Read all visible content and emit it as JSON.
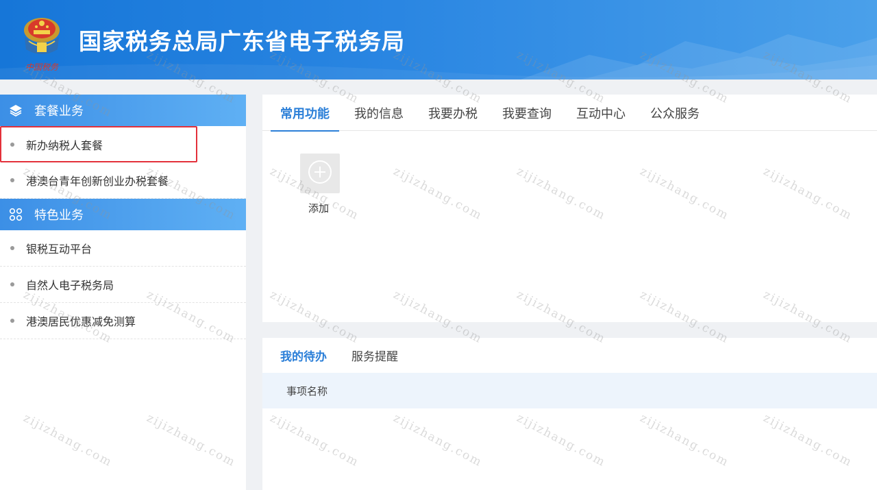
{
  "header": {
    "title": "国家税务总局广东省电子税务局",
    "emblem_caption": "中国税务",
    "colors": {
      "start": "#1676d8",
      "end": "#4aa0ea"
    }
  },
  "sidebar": {
    "sections": [
      {
        "title": "套餐业务",
        "icon": "layers-icon",
        "items": [
          {
            "label": "新办纳税人套餐",
            "selected": true
          },
          {
            "label": "港澳台青年创新创业办税套餐",
            "selected": false
          }
        ]
      },
      {
        "title": "特色业务",
        "icon": "grid-icon",
        "items": [
          {
            "label": "银税互动平台",
            "selected": false
          },
          {
            "label": "自然人电子税务局",
            "selected": false
          },
          {
            "label": "港澳居民优惠减免测算",
            "selected": false
          }
        ]
      }
    ]
  },
  "main": {
    "tabs": [
      {
        "label": "常用功能",
        "active": true
      },
      {
        "label": "我的信息",
        "active": false
      },
      {
        "label": "我要办税",
        "active": false
      },
      {
        "label": "我要查询",
        "active": false
      },
      {
        "label": "互动中心",
        "active": false
      },
      {
        "label": "公众服务",
        "active": false
      }
    ],
    "add_tile": {
      "label": "添加",
      "icon": "plus-circle-icon"
    }
  },
  "todo": {
    "tabs": [
      {
        "label": "我的待办",
        "active": true
      },
      {
        "label": "服务提醒",
        "active": false
      }
    ],
    "table_header": "事项名称"
  },
  "watermark": {
    "text": "zijizhang.com"
  },
  "accent_color": "#2b7fd8",
  "selection_color": "#e3303a"
}
